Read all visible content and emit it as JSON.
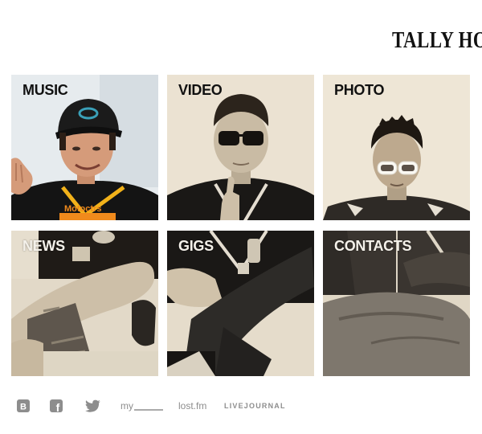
{
  "brand": {
    "logo_text": "TALLY HO!"
  },
  "tiles": {
    "music": "MUSIC",
    "video": "VIDEO",
    "photo": "PHOTO",
    "news": "NEWS",
    "gigs": "GIGS",
    "contacts": "CONTACTS"
  },
  "tshirt_text": "Motoctrs",
  "social": {
    "vk_letter": "B",
    "facebook_letter": "f",
    "myspace_label": "my",
    "lastfm_label": "lost.fm",
    "livejournal_label": "LIVEJOURNAL"
  },
  "colors": {
    "sepia_light": "#e8dfcd",
    "sepia_mid": "#9a8d78",
    "dark": "#1a1816",
    "cap_teal": "#3aa0b8",
    "shirt_orange": "#f08a1c",
    "lanyard_yellow": "#f2b21a",
    "social_gray": "#8d8d8d"
  }
}
